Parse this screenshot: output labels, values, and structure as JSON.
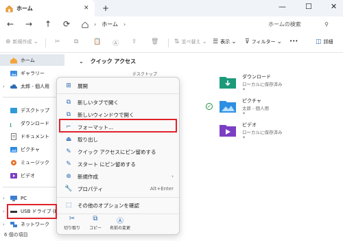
{
  "window": {
    "tab_title": "ホーム",
    "tab_close": "✕",
    "new_tab": "+",
    "controls": {
      "minimize": "—",
      "maximize": "☐",
      "close": "✕"
    }
  },
  "address": {
    "back": "←",
    "forward": "→",
    "up": "↑",
    "refresh": "⟳",
    "crumbs": [
      "ホーム"
    ],
    "search_placeholder": "ホームの検索"
  },
  "toolbar": {
    "new_label": "新規作成",
    "sort_label": "並べ替え",
    "view_label": "表示",
    "filter_label": "フィルター",
    "more_label": "•••",
    "details_label": "詳細"
  },
  "sidebar": {
    "items": [
      {
        "label": "ホーム"
      },
      {
        "label": "ギャラリー"
      },
      {
        "label": "太郎 - 個人用"
      },
      {
        "label": "デスクトップ"
      },
      {
        "label": "ダウンロード"
      },
      {
        "label": "ドキュメント"
      },
      {
        "label": "ピクチャ"
      },
      {
        "label": "ミュージック"
      },
      {
        "label": "ビデオ"
      },
      {
        "label": "PC"
      },
      {
        "label": "USB ドライブ (D:)"
      },
      {
        "label": "ネットワーク"
      }
    ]
  },
  "content": {
    "quick_access_title": "クイック アクセス",
    "partial_label": "デスクトップ",
    "items": [
      {
        "name": "ダウンロード",
        "sub": "ローカルに保存済み"
      },
      {
        "name": "ピクチャ",
        "sub": "太郎 - 個人用"
      },
      {
        "name": "ビデオ",
        "sub": "ローカルに保存済み"
      }
    ]
  },
  "context_menu": {
    "items": [
      {
        "icon": "⊞",
        "label": "展開"
      },
      {
        "icon": "⧉",
        "label": "新しいタブで開く"
      },
      {
        "icon": "⧉",
        "label": "新しいウィンドウで開く"
      },
      {
        "icon": "⌐",
        "label": "フォーマット..."
      },
      {
        "icon": "⏏",
        "label": "取り出し"
      },
      {
        "icon": "✎",
        "label": "クイック アクセスにピン留めする"
      },
      {
        "icon": "✎",
        "label": "スタート にピン留めする"
      },
      {
        "icon": "⊕",
        "label": "新規作成",
        "right": "›"
      },
      {
        "icon": "🔧",
        "label": "プロパティ",
        "right": "Alt+Enter"
      },
      {
        "icon": "⬚",
        "label": "その他のオプションを確認"
      }
    ],
    "bottom": [
      {
        "icon": "✂",
        "label": "切り取り"
      },
      {
        "icon": "⧉",
        "label": "コピー"
      },
      {
        "icon": "Ⓐ",
        "label": "名前の変更"
      }
    ]
  },
  "status": {
    "count": "6 個の項目"
  },
  "colors": {
    "highlight": "#e0222a",
    "accent": "#2d6db5",
    "selected_bg": "#e3e8ef"
  }
}
